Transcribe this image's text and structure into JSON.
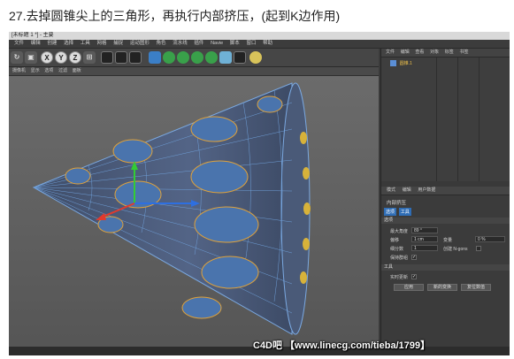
{
  "caption": "27.去掉圆锥尖上的三角形，再执行内部挤压，(起到K边作用)",
  "window": {
    "title": "[未标题 1 *] - 主要"
  },
  "menu": [
    "文件",
    "编辑",
    "创建",
    "选择",
    "工具",
    "网格",
    "捕捉",
    "运动图形",
    "角色",
    "流水线",
    "插件",
    "Navie",
    "脚本",
    "窗口",
    "帮助"
  ],
  "toolbar": {
    "x_label": "X",
    "y_label": "Y",
    "z_label": "Z"
  },
  "viewport": {
    "menu": [
      "摄像机",
      "显示",
      "选项",
      "过滤",
      "面板"
    ]
  },
  "right_panel": {
    "menu": [
      "文件",
      "编辑",
      "查看",
      "对象",
      "标签",
      "书签"
    ],
    "object_name": "圆锥.1"
  },
  "attributes": {
    "tabs": [
      "模式",
      "编辑",
      "用户数据"
    ],
    "title": "内部挤压",
    "subtabs": [
      "选项",
      "工具"
    ],
    "options_header": "选项",
    "max_angle_label": "最大角度",
    "max_angle_value": "89 °",
    "offset_label": "偏移",
    "offset_value": "1 cm",
    "variance_label": "变量",
    "variance_value": "0 %",
    "subdivision_label": "细分数",
    "subdivision_value": "1",
    "ngons_label": "创建 N-gons",
    "keep_groups_label": "保持群组",
    "tool_header": "工具",
    "realtime_label": "实时更新",
    "apply_button": "应用",
    "new_transform_button": "新的变换",
    "reset_button": "复位数值"
  },
  "watermark": "C4D吧 【www.linecg.com/tieba/1799】"
}
